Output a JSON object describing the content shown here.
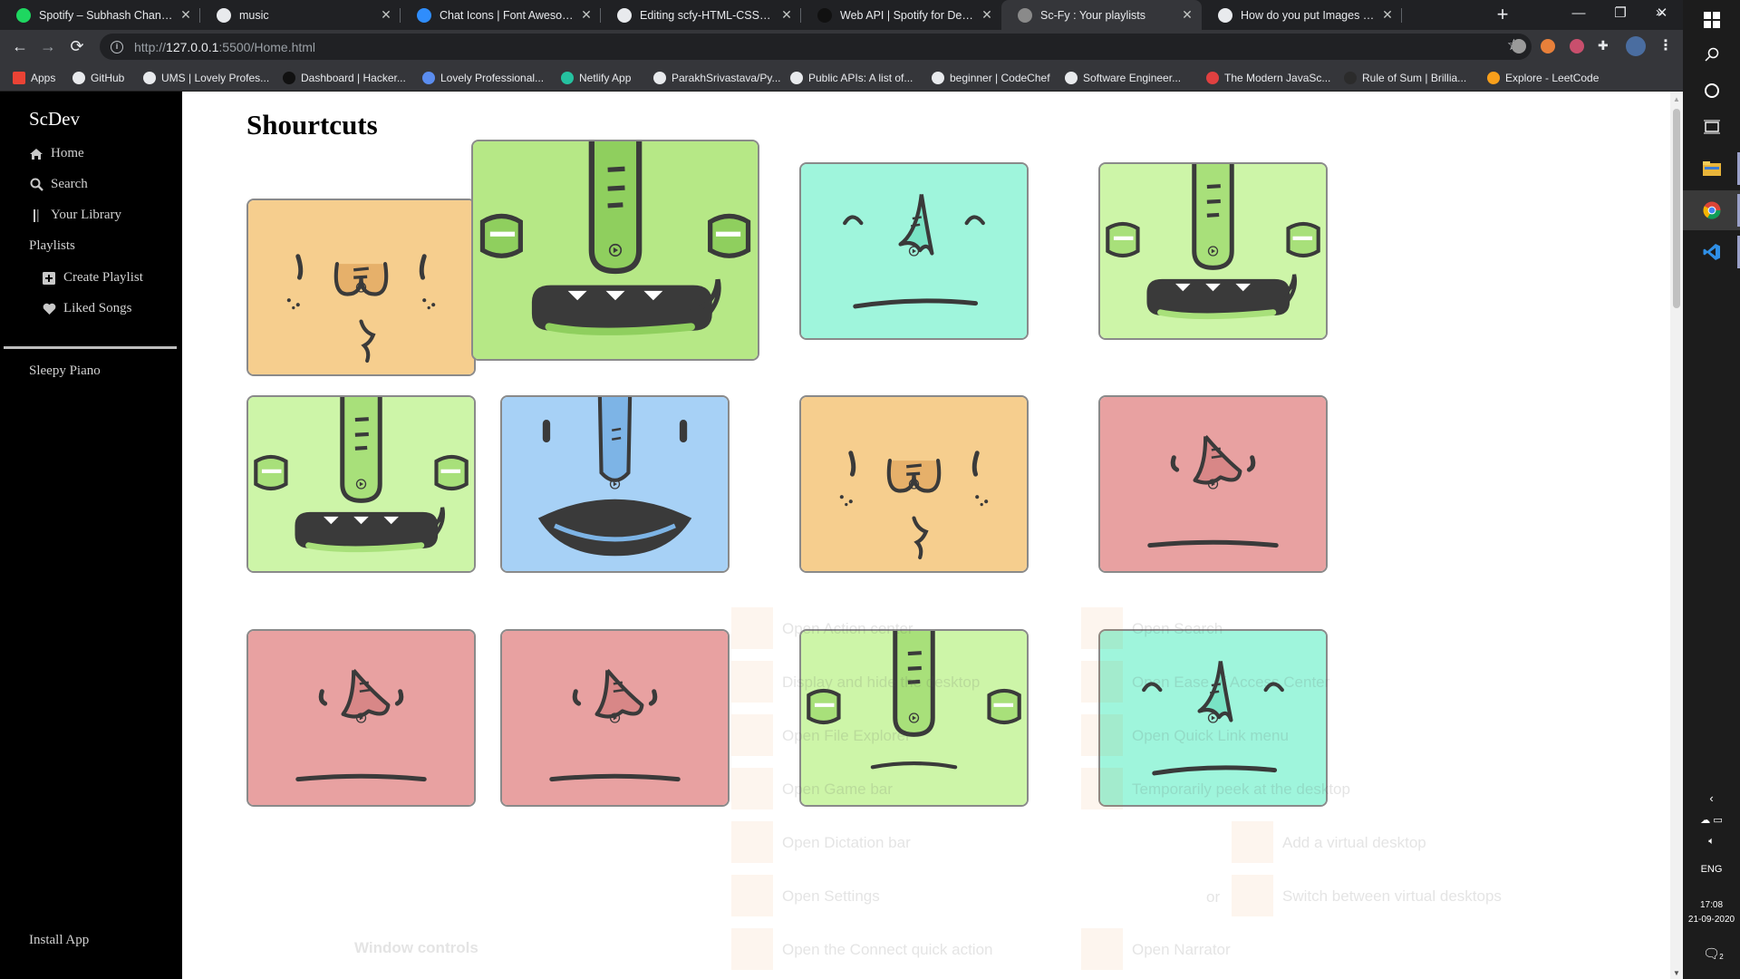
{
  "browser": {
    "tabs": [
      {
        "title": "Spotify – Subhash Chandra",
        "favicon": "spotify-icon",
        "color": "#1ed760"
      },
      {
        "title": "music",
        "favicon": "page-icon",
        "color": "#e8eaed"
      },
      {
        "title": "Chat Icons | Font Awesome",
        "favicon": "font-awesome-icon",
        "color": "#2f8dfc"
      },
      {
        "title": "Editing scfy-HTML-CSS-Javascri",
        "favicon": "github-icon",
        "color": "#e8eaed"
      },
      {
        "title": "Web API | Spotify for Developer",
        "favicon": "spotify-dev-icon",
        "color": "#111111"
      },
      {
        "title": "Sc-Fy : Your playlists",
        "favicon": "globe-icon",
        "color": "#8a8a8a"
      },
      {
        "title": "How do you put Images on the",
        "favicon": "github-icon",
        "color": "#e8eaed"
      }
    ],
    "active_tab": 5,
    "new_tab": "+",
    "window_controls": {
      "minimize": "—",
      "restore": "❐",
      "close": "✕"
    },
    "url_prefix": "http://",
    "url_host": "127.0.0.1",
    "url_rest": ":5500/Home.html",
    "nav": {
      "back": "←",
      "forward": "→",
      "reload": "⟳",
      "bookmark": "☆",
      "menu": "⋮"
    },
    "bookmarks": [
      {
        "label": "Apps",
        "icon": "apps-grid-icon",
        "color": "#ea4335"
      },
      {
        "label": "GitHub",
        "icon": "github-icon",
        "color": "#e8eaed"
      },
      {
        "label": "UMS | Lovely Profes...",
        "icon": "ums-icon",
        "color": "#e8eaed"
      },
      {
        "label": "Dashboard | Hacker...",
        "icon": "hackerearth-icon",
        "color": "#111111"
      },
      {
        "label": "Lovely Professional...",
        "icon": "lpu-icon",
        "color": "#5b8def"
      },
      {
        "label": "Netlify App",
        "icon": "netlify-icon",
        "color": "#25c2a0"
      },
      {
        "label": "ParakhSrivastava/Py...",
        "icon": "github-icon",
        "color": "#e8eaed"
      },
      {
        "label": "Public APIs: A list of...",
        "icon": "public-apis-icon",
        "color": "#e8eaed"
      },
      {
        "label": "beginner | CodeChef",
        "icon": "codechef-icon",
        "color": "#e8eaed"
      },
      {
        "label": "Software Engineer...",
        "icon": "software-eng-icon",
        "color": "#e8eaed"
      },
      {
        "label": "The Modern JavaSc...",
        "icon": "javascript-info-icon",
        "color": "#e04040"
      },
      {
        "label": "Rule of Sum | Brillia...",
        "icon": "brilliant-icon",
        "color": "#2b2b2b"
      },
      {
        "label": "Explore - LeetCode",
        "icon": "leetcode-icon",
        "color": "#f89f1b"
      }
    ],
    "bookmarks_more": "»"
  },
  "app": {
    "brand": "ScDev",
    "nav": [
      {
        "label": "Home",
        "icon": "home-icon"
      },
      {
        "label": "Search",
        "icon": "search-icon"
      },
      {
        "label": "Your Library",
        "icon": "library-icon"
      }
    ],
    "playlists_heading": "Playlists",
    "playlist_actions": [
      {
        "label": "Create Playlist",
        "icon": "plus-square-icon"
      },
      {
        "label": "Liked Songs",
        "icon": "heart-icon"
      }
    ],
    "playlists": [
      "Sleepy Piano"
    ],
    "install": "Install App"
  },
  "main": {
    "heading": "Shourtcuts",
    "cards": [
      {
        "face": "pleased",
        "bg": "#f6ce8e",
        "mouth_bg": "#e6b06a"
      },
      {
        "face": "monster",
        "bg": "#b6e886",
        "mouth_bg": "#8fcf5e"
      },
      {
        "face": "calm",
        "bg": "#9ff5dc",
        "mouth_bg": "#79e3c5"
      },
      {
        "face": "monster",
        "bg": "#cdf5a8",
        "mouth_bg": "#a8e07a"
      },
      {
        "face": "monster",
        "bg": "#cdf5a8",
        "mouth_bg": "#a8e07a"
      },
      {
        "face": "grin",
        "bg": "#a7d1f6",
        "mouth_bg": "#7db4e6"
      },
      {
        "face": "pleased",
        "bg": "#f6ce8e",
        "mouth_bg": "#e6b06a"
      },
      {
        "face": "sad",
        "bg": "#e8a1a1",
        "mouth_bg": "#d88787"
      },
      {
        "face": "sad",
        "bg": "#e8a1a1",
        "mouth_bg": "#d88787"
      },
      {
        "face": "sad",
        "bg": "#e8a1a1",
        "mouth_bg": "#d88787"
      },
      {
        "face": "monster-sad",
        "bg": "#cdf5a8",
        "mouth_bg": "#a8e07a"
      },
      {
        "face": "calm",
        "bg": "#9ff5dc",
        "mouth_bg": "#79e3c5"
      }
    ]
  },
  "overlay_ghost": {
    "items": [
      "Open Action center",
      "Display and hide the desktop",
      "Open File Explorer",
      "Open Game bar",
      "Open Dictation bar",
      "Open Settings",
      "Open the Connect quick action",
      "Open Search",
      "Open Ease of Access Center",
      "Open Quick Link menu",
      "Temporarily peek at the desktop",
      "Add a virtual desktop",
      "Switch between virtual desktops",
      "Open Narrator"
    ],
    "or_text": "or",
    "section": "Window controls"
  },
  "taskbar": {
    "apps": [
      {
        "name": "windows-start-icon"
      },
      {
        "name": "search-icon"
      },
      {
        "name": "cortana-icon"
      },
      {
        "name": "task-view-icon"
      },
      {
        "name": "file-explorer-icon"
      },
      {
        "name": "chrome-icon"
      },
      {
        "name": "vscode-icon"
      }
    ],
    "lang": "ENG",
    "time": "17:08",
    "date": "21-09-2020",
    "notif_count": "2"
  }
}
